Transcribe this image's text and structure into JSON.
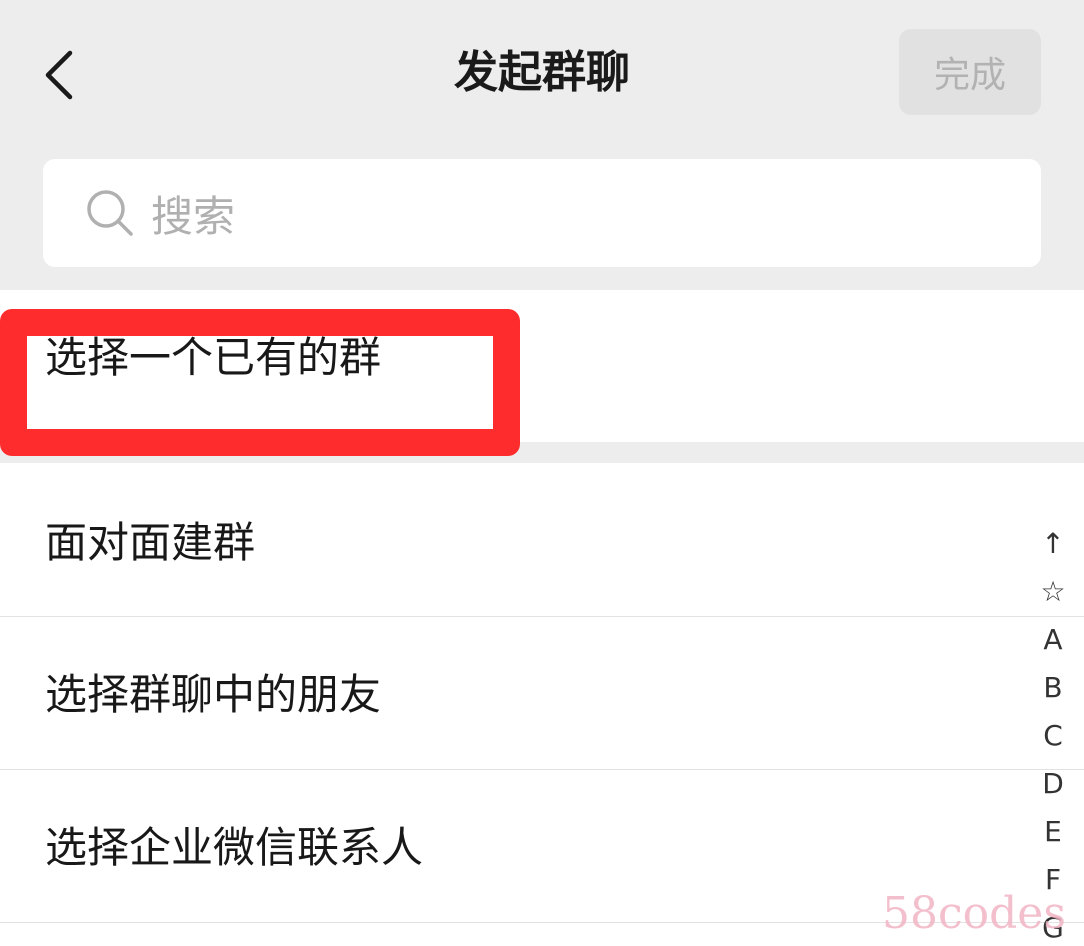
{
  "header": {
    "title": "发起群聊",
    "done_label": "完成"
  },
  "search": {
    "placeholder": "搜索"
  },
  "options": {
    "existing_group": "选择一个已有的群",
    "face_to_face": "面对面建群",
    "from_group_chat": "选择群聊中的朋友",
    "wecom_contacts": "选择企业微信联系人"
  },
  "index_bar": [
    "↑",
    "☆",
    "A",
    "B",
    "C",
    "D",
    "E",
    "F",
    "G"
  ],
  "watermark": "58codes",
  "colors": {
    "background": "#ededed",
    "highlight": "#fe2c2c",
    "done_disabled_text": "#b2b2b2"
  }
}
